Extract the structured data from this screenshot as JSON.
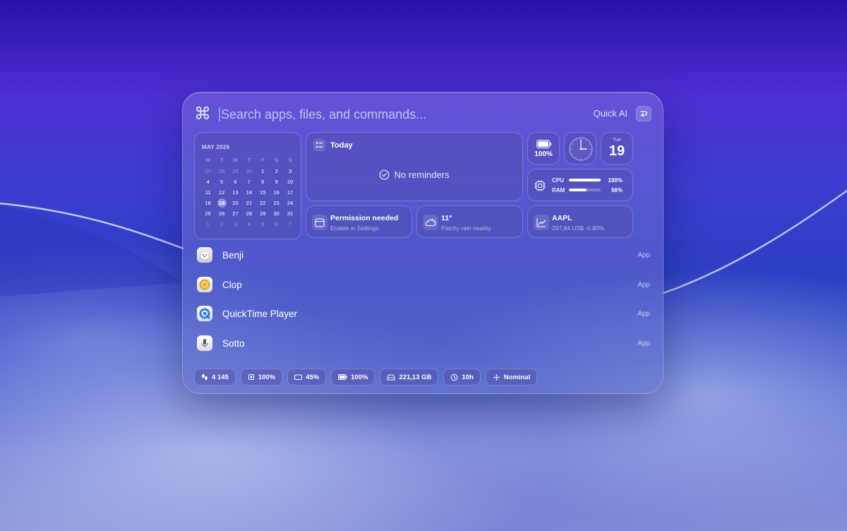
{
  "search": {
    "placeholder": "Search apps, files, and commands...",
    "quick_ai_label": "Quick AI"
  },
  "calendar": {
    "month_label": "MAY 2026",
    "weekdays": [
      "M",
      "T",
      "W",
      "T",
      "F",
      "S",
      "S"
    ],
    "weeks": [
      [
        "27",
        "28",
        "29",
        "30",
        "1",
        "2",
        "3"
      ],
      [
        "4",
        "5",
        "6",
        "7",
        "8",
        "9",
        "10"
      ],
      [
        "11",
        "12",
        "13",
        "14",
        "15",
        "16",
        "17"
      ],
      [
        "18",
        "19",
        "20",
        "21",
        "22",
        "23",
        "24"
      ],
      [
        "25",
        "26",
        "27",
        "28",
        "29",
        "30",
        "31"
      ],
      [
        "1",
        "2",
        "3",
        "4",
        "5",
        "6",
        "7"
      ]
    ],
    "today": "19"
  },
  "reminders": {
    "title": "Today",
    "empty_text": "No reminders"
  },
  "battery_widget": {
    "value": "100%",
    "level": 1.0
  },
  "clock_widget": {
    "hour_hand_deg": 90,
    "minute_hand_deg": 0
  },
  "date_widget": {
    "weekday": "Tue",
    "day": "19"
  },
  "system": {
    "cpu_label": "CPU",
    "cpu_value": "100%",
    "cpu_fraction": 1.0,
    "ram_label": "RAM",
    "ram_value": "56%",
    "ram_fraction": 0.56
  },
  "permission": {
    "title": "Permission needed",
    "subtitle": "Enable in Settings"
  },
  "weather": {
    "temp": "11°",
    "subtitle": "Patchy rain nearby"
  },
  "stock": {
    "symbol": "AAPL",
    "subtitle": "297,84 US$ -0.80%"
  },
  "apps": [
    {
      "name": "Benji",
      "kind": "App",
      "icon": "benji-app-icon",
      "color": "#e8e8ee"
    },
    {
      "name": "Clop",
      "kind": "App",
      "icon": "clop-app-icon",
      "color": "#e9b94a"
    },
    {
      "name": "QuickTime Player",
      "kind": "App",
      "icon": "quicktime-app-icon",
      "color": "#2f7de1"
    },
    {
      "name": "Sotto",
      "kind": "App",
      "icon": "sotto-app-icon",
      "color": "#f2f2f4"
    }
  ],
  "status_bar": {
    "steps": "4 145",
    "cpu": "100%",
    "memory": "45%",
    "battery": "100%",
    "disk": "221,13 GB",
    "uptime": "10h",
    "thermal": "Nominal"
  }
}
